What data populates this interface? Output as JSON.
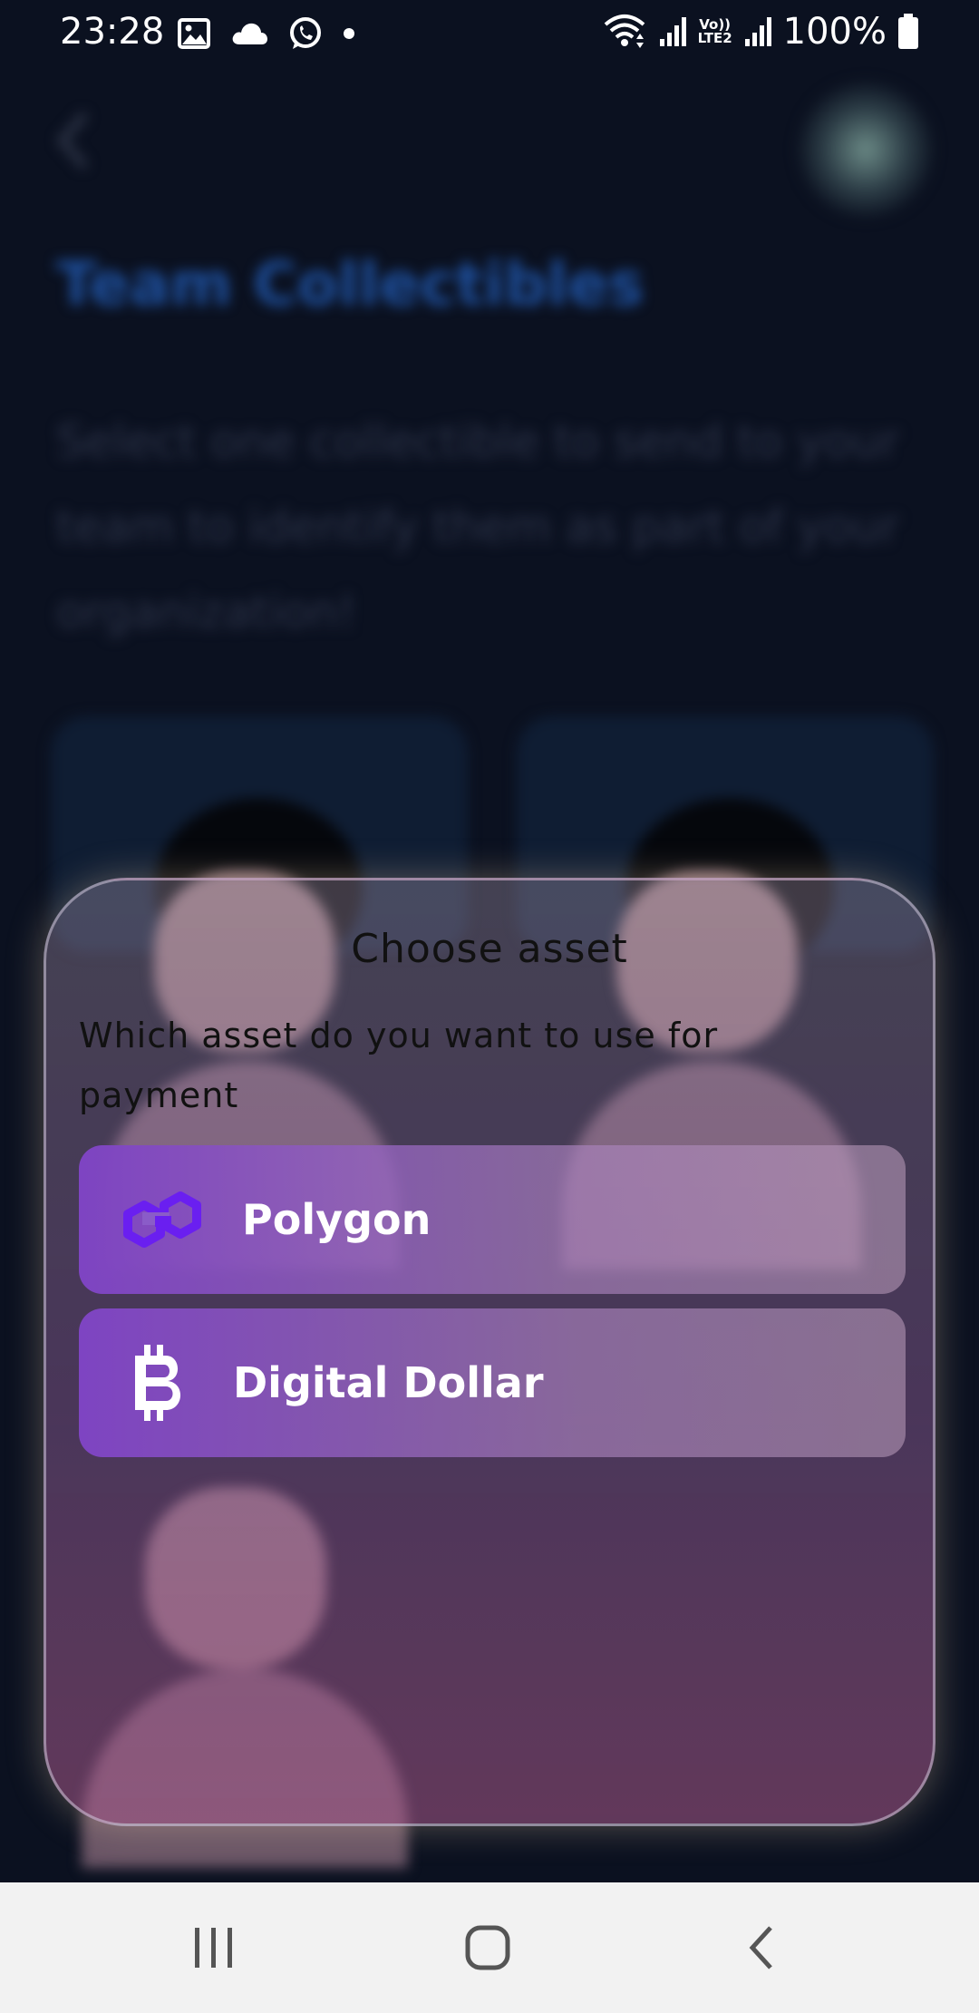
{
  "status_bar": {
    "time": "23:28",
    "battery": "100%",
    "volte_top": "Vo))",
    "volte_bottom": "LTE2",
    "left_icons": [
      "gallery-icon",
      "cloud-icon",
      "whatsapp-icon",
      "dot-icon"
    ],
    "right_icons": [
      "wifi-icon",
      "signal-icon",
      "volte-icon",
      "signal-icon",
      "battery-icon"
    ]
  },
  "background_page": {
    "title": "Team Collectibles",
    "description": "Select one collectible to send to your team to identify them as part of your organization!"
  },
  "modal": {
    "title": "Choose asset",
    "subtitle": "Which asset do you want to use for payment",
    "options": [
      {
        "label": "Polygon",
        "icon": "polygon-icon",
        "icon_color": "#6a1ff0"
      },
      {
        "label": "Digital Dollar",
        "icon": "bitcoin-icon",
        "icon_color": "#ffffff"
      }
    ]
  },
  "nav_bar": {
    "buttons": [
      "recent-apps-icon",
      "home-icon",
      "back-icon"
    ]
  },
  "colors": {
    "background": "#0b1120",
    "option_accent": "#7e44c2",
    "nav_bar": "#f2f2f2"
  }
}
